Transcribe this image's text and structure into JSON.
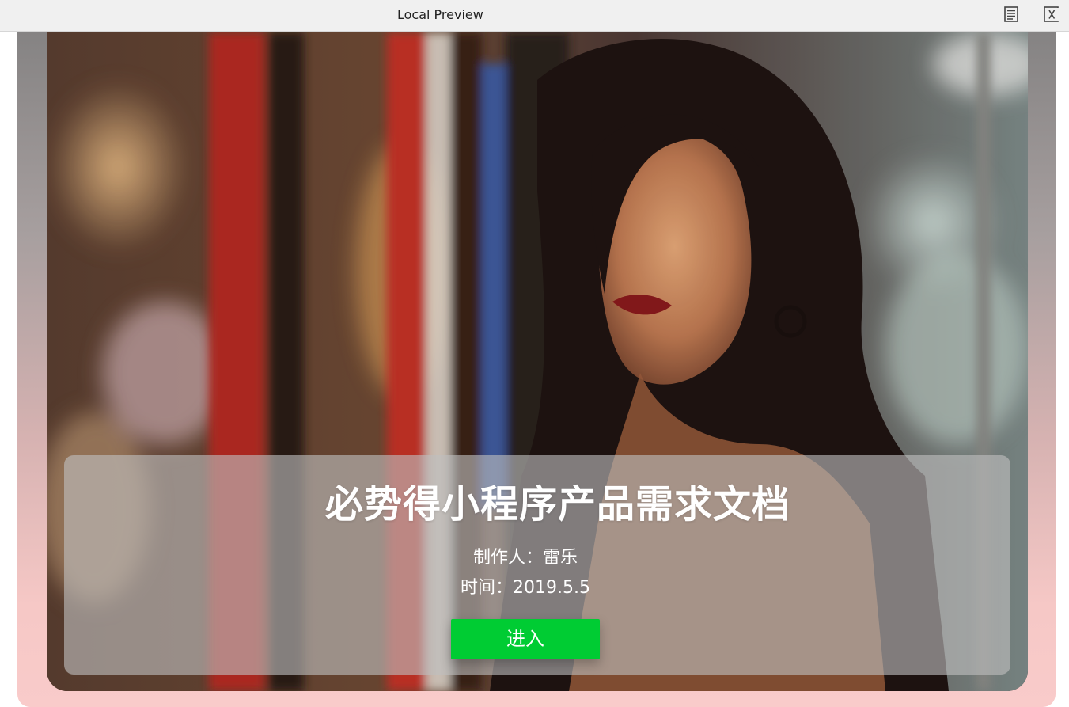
{
  "window": {
    "title": "Local Preview",
    "icons": [
      "document-icon",
      "close-icon"
    ]
  },
  "cover": {
    "photo_icon": "cover-photo",
    "title": "必势得小程序产品需求文档",
    "author_line": "制作人：雷乐",
    "date_line": "时间：2019.5.5",
    "enter_label": "进入",
    "colors": {
      "button": "#00cc33",
      "overlay": "rgba(190,190,190,0.62)",
      "background_top": "#858383",
      "background_bottom": "#f9cbca"
    }
  }
}
